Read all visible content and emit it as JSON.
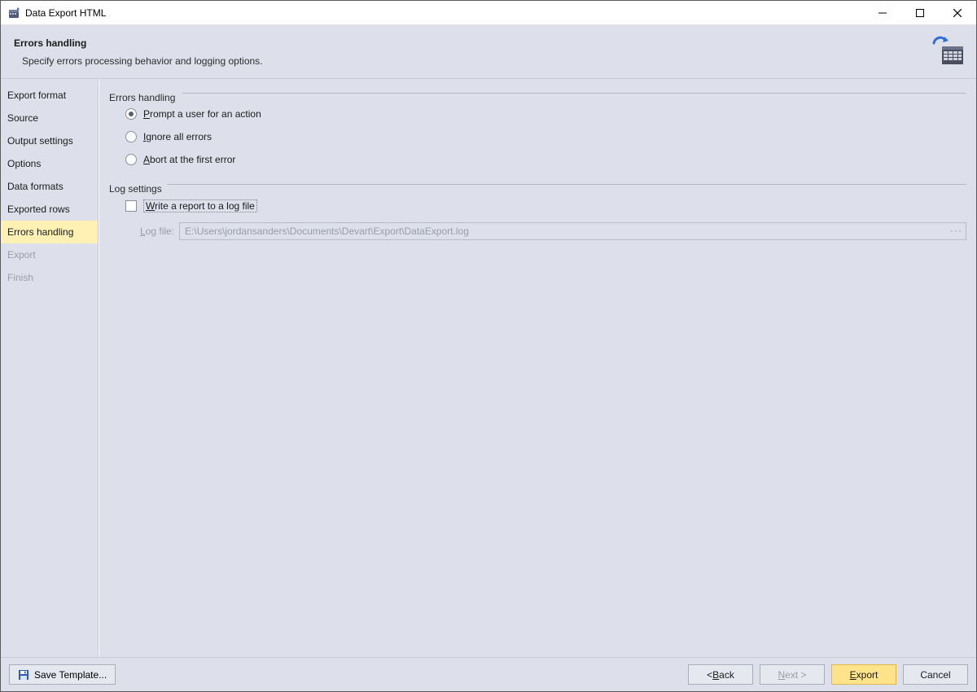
{
  "window": {
    "title": "Data Export HTML"
  },
  "header": {
    "title": "Errors handling",
    "description": "Specify errors processing behavior and logging options."
  },
  "sidebar": {
    "items": [
      {
        "label": "Export format",
        "state": "normal"
      },
      {
        "label": "Source",
        "state": "normal"
      },
      {
        "label": "Output settings",
        "state": "normal"
      },
      {
        "label": "Options",
        "state": "normal"
      },
      {
        "label": "Data formats",
        "state": "normal"
      },
      {
        "label": "Exported rows",
        "state": "normal"
      },
      {
        "label": "Errors handling",
        "state": "selected"
      },
      {
        "label": "Export",
        "state": "disabled"
      },
      {
        "label": "Finish",
        "state": "disabled"
      }
    ]
  },
  "errorsGroup": {
    "legend": "Errors handling",
    "radios": {
      "prompt": {
        "pre": "",
        "accel": "P",
        "post": "rompt a user for an action",
        "selected": true
      },
      "ignore": {
        "pre": "",
        "accel": "I",
        "post": "gnore all errors",
        "selected": false
      },
      "abort": {
        "pre": "",
        "accel": "A",
        "post": "bort at the first error",
        "selected": false
      }
    }
  },
  "logGroup": {
    "legend": "Log settings",
    "checkbox": {
      "pre": "",
      "accel": "W",
      "post": "rite a report to a log file",
      "checked": false
    },
    "logFileLabel": {
      "pre": "",
      "accel": "L",
      "post": "og file:"
    },
    "logFileValue": "E:\\Users\\jordansanders\\Documents\\Devart\\Export\\DataExport.log"
  },
  "footer": {
    "saveTemplate": "Save Template...",
    "back": {
      "pre": "< ",
      "accel": "B",
      "post": "ack"
    },
    "next": {
      "pre": "",
      "accel": "N",
      "post": "ext >"
    },
    "export": {
      "pre": "",
      "accel": "E",
      "post": "xport"
    },
    "cancel": "Cancel"
  }
}
